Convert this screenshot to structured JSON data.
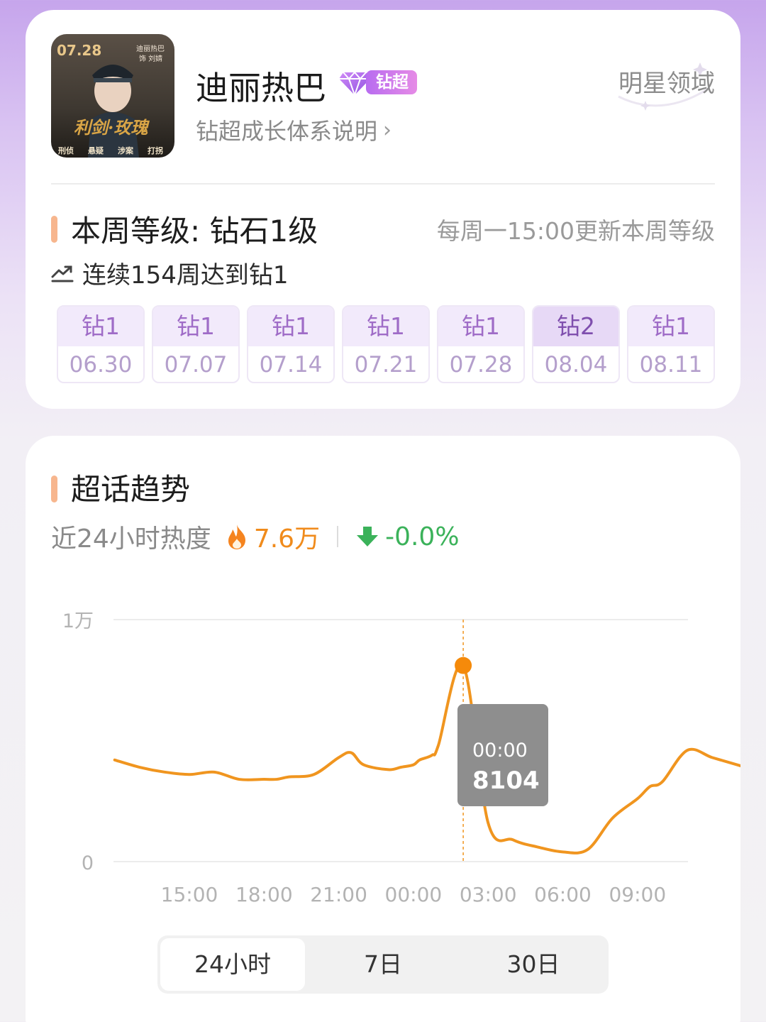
{
  "header": {
    "poster": {
      "date": "07.28",
      "caption_top": "迪丽热巴",
      "caption_role": "饰 刘婧",
      "title_art": "利剑·玫瑰",
      "tags": [
        "刑侦",
        "悬疑",
        "涉案",
        "打拐"
      ]
    },
    "name": "迪丽热巴",
    "badge_label": "钻超",
    "growth_link": "钻超成长体系说明",
    "domain_link": "明星领域"
  },
  "level": {
    "title": "本周等级: 钻石1级",
    "update_note": "每周一15:00更新本周等级",
    "streak": "连续154周达到钻1",
    "weeks": [
      {
        "level": "钻1",
        "date": "06.30"
      },
      {
        "level": "钻1",
        "date": "07.07"
      },
      {
        "level": "钻1",
        "date": "07.14"
      },
      {
        "level": "钻1",
        "date": "07.21"
      },
      {
        "level": "钻1",
        "date": "07.28"
      },
      {
        "level": "钻2",
        "date": "08.04"
      },
      {
        "level": "钻1",
        "date": "08.11"
      }
    ]
  },
  "trend": {
    "title": "超话趋势",
    "heat_label": "近24小时热度",
    "heat_value": "7.6万",
    "delta": "-0.0%",
    "tabs": [
      "24小时",
      "7日",
      "30日"
    ],
    "active_tab": "24小时",
    "tooltip": {
      "time": "00:00",
      "value": "8104"
    }
  },
  "colors": {
    "accent": "#f0951f",
    "up_down_green": "#3bb25a",
    "badge_purple": "#b86cf0"
  },
  "chart_data": {
    "type": "line",
    "title": "",
    "xlabel": "",
    "ylabel": "",
    "y_tick_labels": [
      "1万",
      "0"
    ],
    "ylim": [
      0,
      10000
    ],
    "x_tick_labels": [
      "15:00",
      "18:00",
      "21:00",
      "00:00",
      "03:00",
      "06:00",
      "09:00"
    ],
    "x_hours_from_first_tick": [
      -3,
      -2,
      -1,
      0,
      1,
      2,
      3,
      3.5,
      4,
      5,
      6,
      6.5,
      7,
      8,
      8.5,
      9,
      9.25,
      9.75,
      10,
      11,
      12,
      13,
      14,
      15,
      16,
      17,
      18,
      18.5,
      19,
      20,
      21,
      22,
      23
    ],
    "values": [
      4200,
      3900,
      3700,
      3600,
      3700,
      3400,
      3400,
      3400,
      3500,
      3600,
      4300,
      4500,
      4000,
      3800,
      3900,
      4000,
      4200,
      4400,
      4800,
      8104,
      1600,
      900,
      600,
      400,
      500,
      1800,
      2600,
      3100,
      3300,
      4600,
      4300,
      4000,
      3700
    ],
    "highlight_index": 19,
    "grid": true,
    "legend": "none"
  }
}
